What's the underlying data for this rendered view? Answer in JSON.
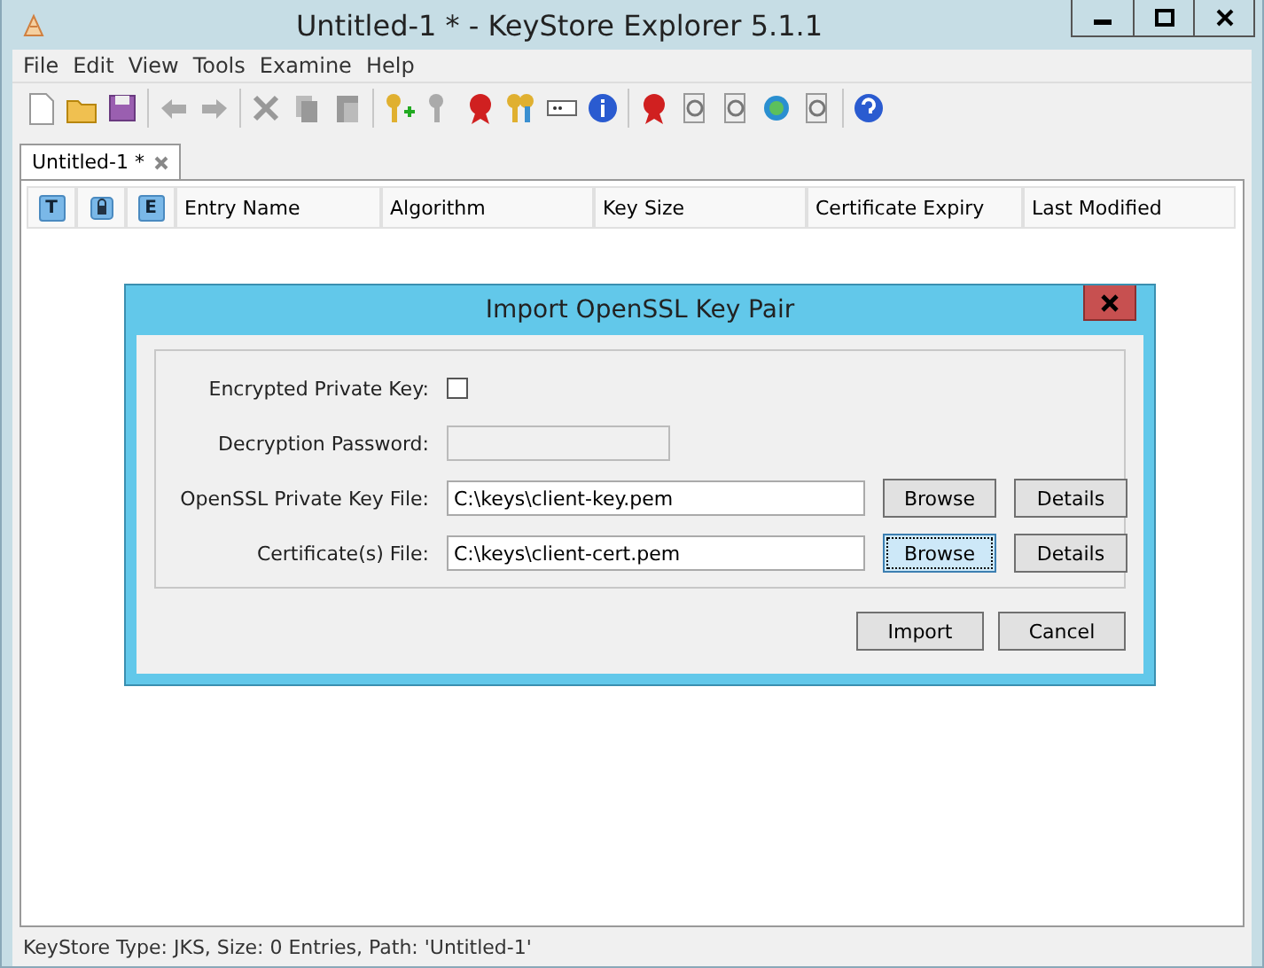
{
  "window": {
    "title": "Untitled-1 * - KeyStore Explorer 5.1.1"
  },
  "menu": [
    "File",
    "Edit",
    "View",
    "Tools",
    "Examine",
    "Help"
  ],
  "tabs": [
    {
      "label": "Untitled-1 *",
      "selected": true
    }
  ],
  "table": {
    "columns": [
      {
        "kind": "letter",
        "text": "T"
      },
      {
        "kind": "lock"
      },
      {
        "kind": "letter",
        "text": "E"
      },
      {
        "kind": "text",
        "text": "Entry Name"
      },
      {
        "kind": "text",
        "text": "Algorithm"
      },
      {
        "kind": "text",
        "text": "Key Size"
      },
      {
        "kind": "text",
        "text": "Certificate Expiry"
      },
      {
        "kind": "text",
        "text": "Last Modified"
      }
    ]
  },
  "dialog": {
    "title": "Import OpenSSL Key Pair",
    "rows": [
      {
        "kind": "checkbox",
        "label": "Encrypted Private Key:",
        "checked": false
      },
      {
        "kind": "field",
        "label": "Decryption Password:",
        "disabled": true
      },
      {
        "kind": "file",
        "label": "OpenSSL Private Key File:",
        "value": "C:\\keys\\client-key.pem",
        "buttons": [
          {
            "label": "Browse",
            "focused": false
          },
          {
            "label": "Details",
            "focused": false
          }
        ]
      },
      {
        "kind": "file",
        "label": "Certificate(s) File:",
        "value": "C:\\keys\\client-cert.pem",
        "buttons": [
          {
            "label": "Browse",
            "focused": true
          },
          {
            "label": "Details",
            "focused": false
          }
        ]
      }
    ],
    "buttons": [
      "Import",
      "Cancel"
    ]
  },
  "status_bar": "KeyStore Type: JKS, Size: 0 Entries, Path: 'Untitled-1'"
}
